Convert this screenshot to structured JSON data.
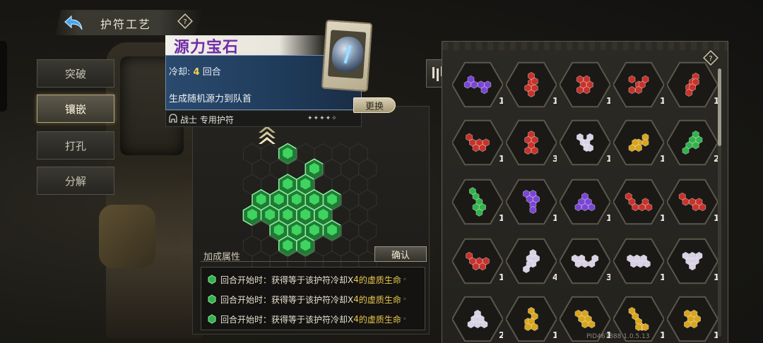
{
  "header": {
    "title": "护符工艺",
    "back_icon": "back-arrow-icon",
    "info_icon": "info-diamond-icon"
  },
  "nav": {
    "items": [
      {
        "label": "突破",
        "active": false
      },
      {
        "label": "镶嵌",
        "active": true
      },
      {
        "label": "打孔",
        "active": false
      },
      {
        "label": "分解",
        "active": false
      }
    ]
  },
  "charm": {
    "name": "源力宝石",
    "cooldown_label": "冷却:",
    "cooldown_value": "4",
    "cooldown_unit": "回合",
    "effect": "生成随机源力到队首",
    "class_label": "战士 专用护符",
    "swap_label": "更换",
    "name_color": "#6f2da8"
  },
  "socket": {
    "bonus_title": "加成属性",
    "confirm_label": "确认",
    "bonus_rows": [
      {
        "prefix": "回合开始时：获得等于该护符冷却X",
        "num": "4",
        "suffix": "的虚质生命"
      },
      {
        "prefix": "回合开始时：获得等于该护符冷却X",
        "num": "4",
        "suffix": "的虚质生命"
      },
      {
        "prefix": "回合开始时：获得等于该护符冷却X",
        "num": "4",
        "suffix": "的虚质生命"
      }
    ]
  },
  "colors": {
    "green": "#2fb34a",
    "red": "#c8322a",
    "purple": "#7a45d6",
    "white": "#d9d2e6",
    "yellow": "#d9a51a"
  },
  "inventory": {
    "slots": [
      {
        "color": "purple",
        "count": "1"
      },
      {
        "color": "red",
        "count": "1"
      },
      {
        "color": "red",
        "count": "1"
      },
      {
        "color": "red",
        "count": "1"
      },
      {
        "color": "red",
        "count": "1"
      },
      {
        "color": "red",
        "count": "1"
      },
      {
        "color": "red",
        "count": "3"
      },
      {
        "color": "white",
        "count": "1"
      },
      {
        "color": "yellow",
        "count": "1"
      },
      {
        "color": "green",
        "count": "2"
      },
      {
        "color": "green",
        "count": "1"
      },
      {
        "color": "purple",
        "count": "1"
      },
      {
        "color": "purple",
        "count": "1"
      },
      {
        "color": "red",
        "count": "1"
      },
      {
        "color": "red",
        "count": "1"
      },
      {
        "color": "red",
        "count": "1"
      },
      {
        "color": "white",
        "count": "4"
      },
      {
        "color": "white",
        "count": "3"
      },
      {
        "color": "white",
        "count": "1"
      },
      {
        "color": "white",
        "count": "1"
      },
      {
        "color": "white",
        "count": "2"
      },
      {
        "color": "yellow",
        "count": "1"
      },
      {
        "color": "yellow",
        "count": "1"
      },
      {
        "color": "yellow",
        "count": "1"
      },
      {
        "color": "yellow",
        "count": "1"
      }
    ]
  },
  "footer": {
    "build": "PID467888 1.0.5.13"
  }
}
